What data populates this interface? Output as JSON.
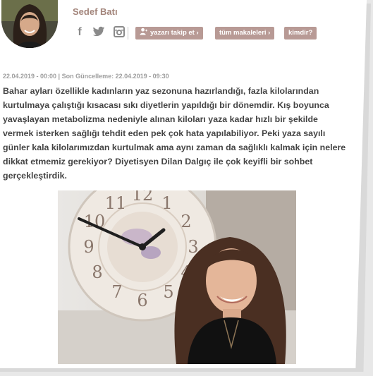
{
  "author": {
    "name": "Sedef Batı"
  },
  "social": {
    "icons": [
      "facebook-icon",
      "twitter-icon",
      "instagram-icon"
    ]
  },
  "actions": {
    "follow_label": "yazarı takip et ›",
    "articles_label": "tüm makaleleri ›",
    "who_label": "kimdir?"
  },
  "colors": {
    "accent": "#b89a95",
    "author_name": "#a3857b",
    "body_text": "#444444",
    "meta_text": "#9e9e9e"
  },
  "article": {
    "dateline": "22.04.2019 - 00:00 | Son Güncelleme: 22.04.2019 - 09:30",
    "lead": "Bahar ayları özellikle kadınların yaz sezonuna hazırlandığı, fazla kilolarından kurtulmaya çalıştığı kısacası sıkı diyetlerin yapıldığı bir dönemdir. Kış boyunca yavaşlayan metabolizma nedeniyle alınan kiloları yaza kadar hızlı bir şekilde vermek isterken sağlığı tehdit eden pek çok hata yapılabiliyor. Peki yaza sayılı günler kala kilolarımızdan kurtulmak ama aynı zaman da sağlıklı kalmak için nelere dikkat etmemiz gerekiyor? Diyetisyen Dilan Dalgıç ile çok keyifli bir sohbet gerçekleştirdik."
  },
  "photo": {
    "clock_numerals": [
      "12",
      "1",
      "2",
      "3",
      "4",
      "5",
      "6",
      "7",
      "8",
      "9",
      "10",
      "11"
    ]
  }
}
